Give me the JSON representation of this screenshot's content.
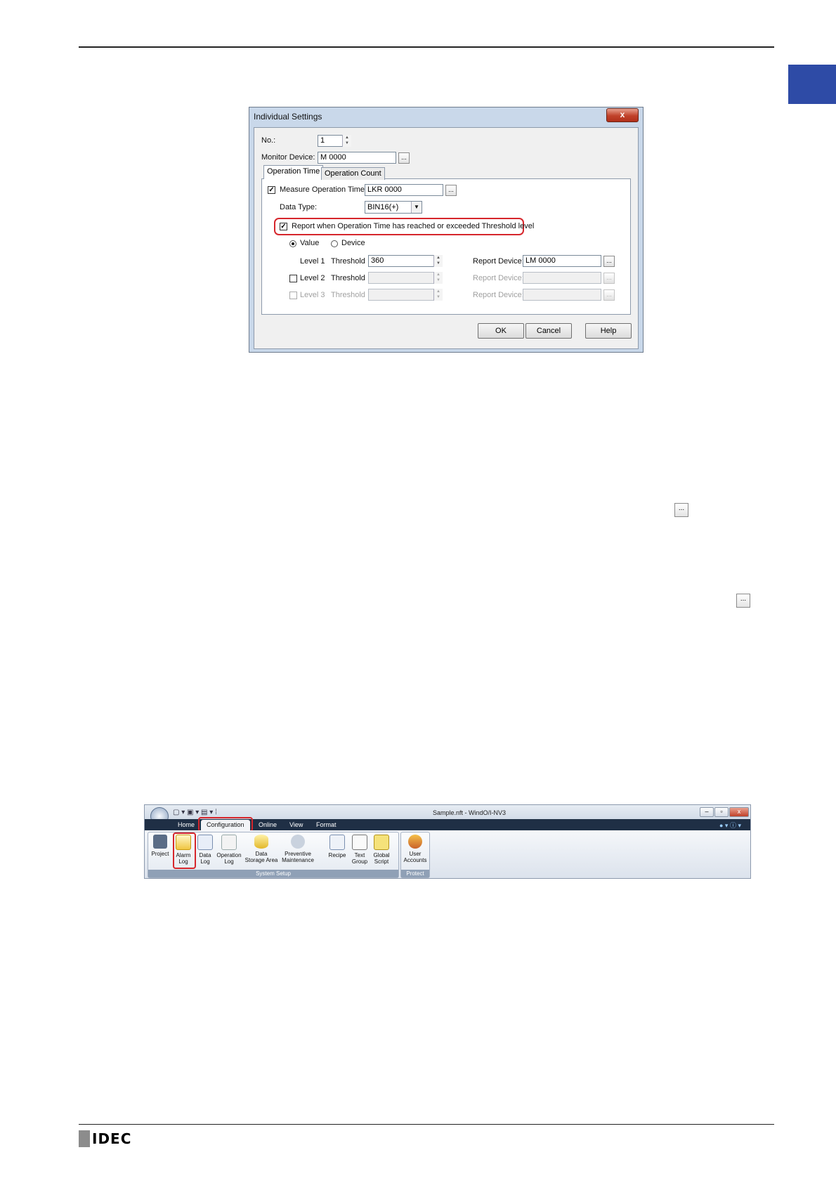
{
  "dialog": {
    "title": "Individual Settings",
    "close_label": "x",
    "no_label": "No.:",
    "no_value": "1",
    "monitor_label": "Monitor Device:",
    "monitor_value": "M 0000",
    "browse_label": "...",
    "tabs": [
      "Operation Time",
      "Operation Count"
    ],
    "measure_label": "Measure Operation Time:",
    "measure_checked": true,
    "measure_value": "LKR 0000",
    "data_type_label": "Data Type:",
    "data_type_value": "BIN16(+)",
    "report_label": "Report when Operation Time has reached or exceeded Threshold level",
    "report_checked": true,
    "radio_value": "Value",
    "radio_device": "Device",
    "level1": "Level 1",
    "level2": "Level 2",
    "level3": "Level 3",
    "threshold": "Threshold",
    "threshold1_value": "360",
    "report_device_label": "Report Device:",
    "report_device1_value": "LM 0000",
    "ok": "OK",
    "cancel": "Cancel",
    "help": "Help"
  },
  "inline_icons": {
    "ellipsis": "..."
  },
  "ribbon": {
    "window_title": "Sample.nft - WindO/I-NV3",
    "tabs": [
      "Home",
      "Configuration",
      "Online",
      "View",
      "Format"
    ],
    "buttons": {
      "project": "Project",
      "alarm_log": [
        "Alarm",
        "Log"
      ],
      "data_log": [
        "Data",
        "Log"
      ],
      "operation_log": [
        "Operation",
        "Log"
      ],
      "data_storage": [
        "Data",
        "Storage Area"
      ],
      "preventive": [
        "Preventive",
        "Maintenance"
      ],
      "recipe": "Recipe",
      "text_group": [
        "Text",
        "Group"
      ],
      "global_script": [
        "Global",
        "Script"
      ],
      "user_accounts": [
        "User",
        "Accounts"
      ]
    },
    "group_system_setup": "System Setup",
    "group_protect": "Protect"
  },
  "footer": {
    "logo": "IDEC"
  },
  "colors": {
    "side_tab": "#2e4ba6",
    "highlight": "#d6262c"
  }
}
